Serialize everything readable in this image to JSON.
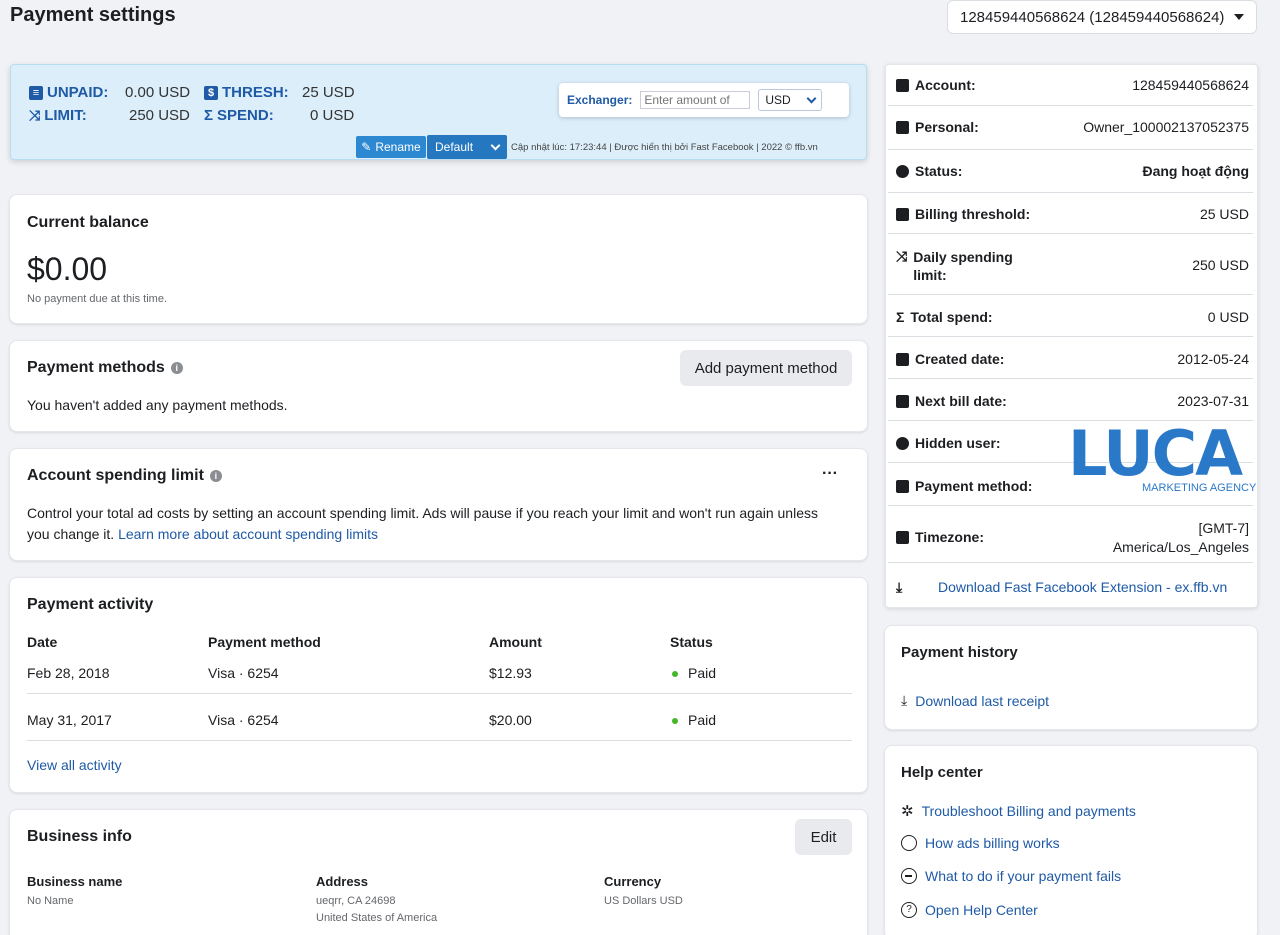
{
  "page_title": "Payment settings",
  "account_selector": "128459440568624 (128459440568624)",
  "extension": {
    "unpaid_label": "UNPAID:",
    "unpaid_value": "0.00 USD",
    "thresh_label": "THRESH:",
    "thresh_value": "25 USD",
    "limit_label": "LIMIT:",
    "limit_value": "250 USD",
    "spend_label": "SPEND:",
    "spend_value": "0 USD",
    "exchanger_label": "Exchanger:",
    "exchanger_placeholder": "Enter amount of",
    "currency": "USD",
    "rename_label": "Rename",
    "default_label": "Default",
    "updated_text": "Cập nhật lúc: 17:23:44 | Được hiển thị bởi Fast Facebook | 2022 © ffb.vn"
  },
  "balance": {
    "title": "Current balance",
    "amount": "$0.00",
    "note": "No payment due at this time."
  },
  "payment_methods": {
    "title": "Payment methods",
    "add_label": "Add payment method",
    "empty_text": "You haven't added any payment methods."
  },
  "spending_limit": {
    "title": "Account spending limit",
    "more": "···",
    "description": "Control your total ad costs by setting an account spending limit. Ads will pause if you reach your limit and won't run again unless you change it.",
    "learn_more": "Learn more about account spending limits"
  },
  "activity": {
    "title": "Payment activity",
    "headers": [
      "Date",
      "Payment method",
      "Amount",
      "Status"
    ],
    "rows": [
      {
        "date": "Feb 28, 2018",
        "method": "Visa · 6254",
        "amount": "$12.93",
        "status": "Paid"
      },
      {
        "date": "May 31, 2017",
        "method": "Visa · 6254",
        "amount": "$20.00",
        "status": "Paid"
      }
    ],
    "view_all": "View all activity"
  },
  "business": {
    "title": "Business info",
    "edit_label": "Edit",
    "name_label": "Business name",
    "name_value": "No Name",
    "address_label": "Address",
    "address_line1": "ueqrr, CA 24698",
    "address_line2": "United States of America",
    "currency_label": "Currency",
    "currency_value": "US Dollars USD"
  },
  "account_info": {
    "rows": [
      {
        "key": "Account:",
        "value": "128459440568624"
      },
      {
        "key": "Personal:",
        "value": "Owner_100002137052375"
      },
      {
        "key": "Status:",
        "value": "Đang hoạt động"
      },
      {
        "key": "Billing threshold:",
        "value": "25 USD"
      },
      {
        "key": "Daily spending limit:",
        "value": "250 USD"
      },
      {
        "key": "Total spend:",
        "value": "0 USD"
      },
      {
        "key": "Created date:",
        "value": "2012-05-24"
      },
      {
        "key": "Next bill date:",
        "value": "2023-07-31"
      },
      {
        "key": "Hidden user:",
        "value": ""
      },
      {
        "key": "Payment method:",
        "value": ""
      },
      {
        "key": "Timezone:",
        "value": "[GMT-7]",
        "value2": "America/Los_Angeles"
      }
    ],
    "download_link": "Download Fast Facebook Extension - ex.ffb.vn"
  },
  "watermark": {
    "letters": "LUCA",
    "tagline": "MARKETING AGENCY"
  },
  "payment_history": {
    "title": "Payment history",
    "download_receipt": "Download last receipt"
  },
  "help_center": {
    "title": "Help center",
    "items": [
      {
        "label": "Troubleshoot Billing and payments",
        "icon": "wrench-icon"
      },
      {
        "label": "How ads billing works",
        "icon": "globe-icon"
      },
      {
        "label": "What to do if your payment fails",
        "icon": "minus-circle-icon"
      },
      {
        "label": "Open Help Center",
        "icon": "question-icon"
      }
    ]
  }
}
